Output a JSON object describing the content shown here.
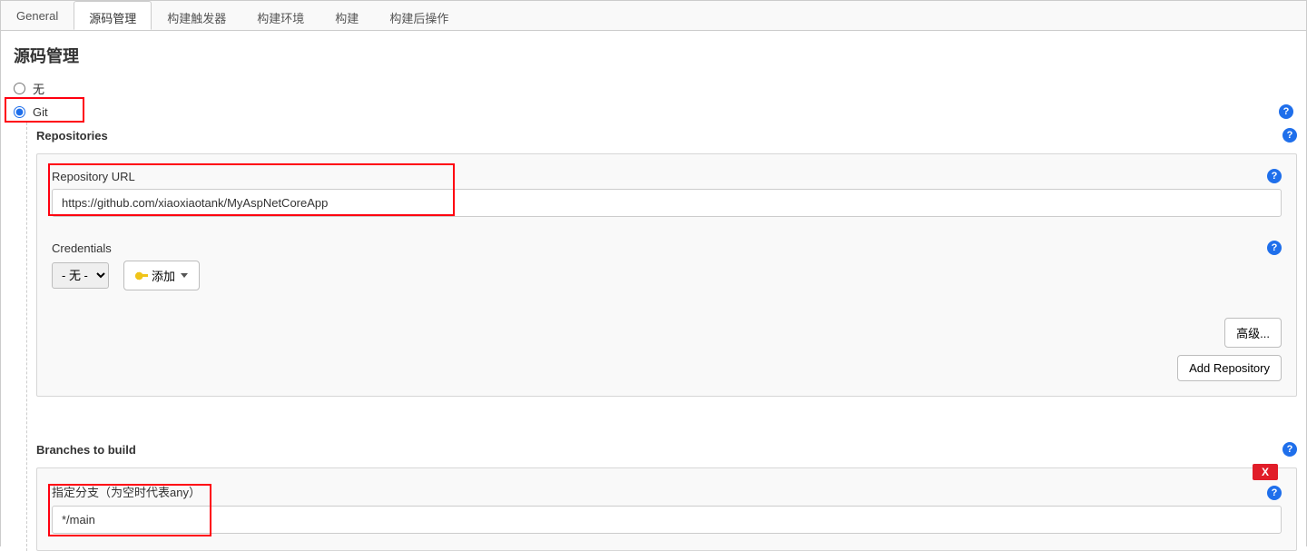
{
  "tabs": {
    "general": "General",
    "scm": "源码管理",
    "triggers": "构建触发器",
    "env": "构建环境",
    "build": "构建",
    "post": "构建后操作"
  },
  "section": {
    "title": "源码管理",
    "option_none_label": "无",
    "option_git_label": "Git",
    "repositories_label": "Repositories",
    "repo_url_label": "Repository URL",
    "repo_url_value": "https://github.com/xiaoxiaotank/MyAspNetCoreApp",
    "credentials_label": "Credentials",
    "credentials_none_option": "- 无 -",
    "add_button_label": "添加",
    "advanced_button_label": "高级...",
    "add_repository_button_label": "Add Repository",
    "branches_label": "Branches to build",
    "branch_specifier_label": "指定分支（为空时代表any）",
    "branch_value": "*/main",
    "delete_button_label": "X"
  },
  "icons": {
    "help": "?"
  }
}
